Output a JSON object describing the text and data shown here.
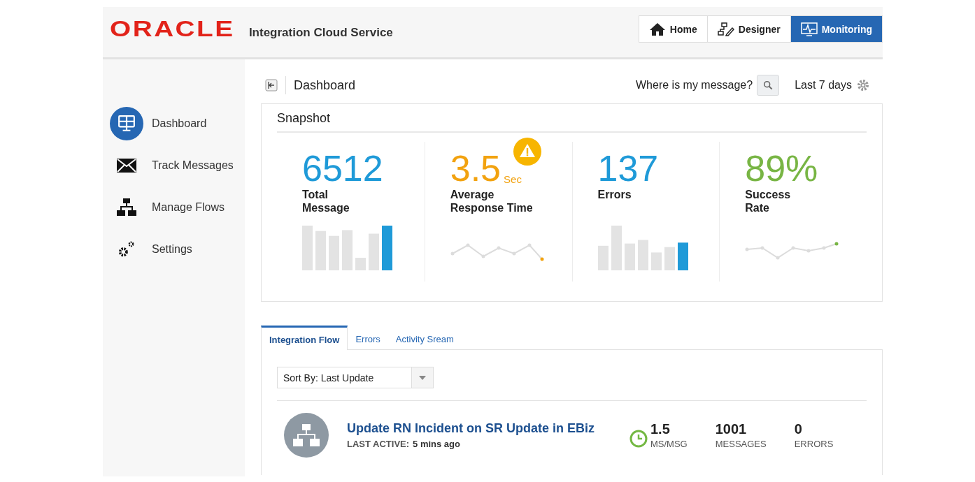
{
  "header": {
    "logo": "ORACLE",
    "product": "Integration Cloud Service",
    "nav": [
      {
        "label": "Home",
        "selected": false
      },
      {
        "label": "Designer",
        "selected": false
      },
      {
        "label": "Monitoring",
        "selected": true
      }
    ]
  },
  "sidebar": {
    "items": [
      {
        "label": "Dashboard",
        "selected": true
      },
      {
        "label": "Track Messages",
        "selected": false
      },
      {
        "label": "Manage Flows",
        "selected": false
      },
      {
        "label": "Settings",
        "selected": false
      }
    ]
  },
  "page": {
    "title": "Dashboard",
    "search_label": "Where is my message?",
    "period": "Last 7 days"
  },
  "snapshot": {
    "title": "Snapshot",
    "cards": [
      {
        "value": "6512",
        "label_lines": [
          "Total",
          "Message"
        ],
        "color": "#1f9ad8",
        "kind": "bars"
      },
      {
        "value": "3.5",
        "unit": "Sec",
        "label_lines": [
          "Average",
          "Response Time"
        ],
        "color": "#f2a20f",
        "warning": true,
        "kind": "line"
      },
      {
        "value": "137",
        "label_lines": [
          "Errors"
        ],
        "color": "#1f9ad8",
        "kind": "bars"
      },
      {
        "value": "89%",
        "label_lines": [
          "Success",
          "Rate"
        ],
        "color": "#78b544",
        "kind": "line"
      }
    ]
  },
  "tabs": [
    {
      "label": "Integration Flow",
      "selected": true
    },
    {
      "label": "Errors",
      "selected": false
    },
    {
      "label": "Activity Sream",
      "selected": false
    }
  ],
  "sort": {
    "value": "Sort By: Last Update"
  },
  "flows": [
    {
      "name": "Update RN Incident on SR Update in EBiz",
      "last_active_label": "LAST ACTIVE:",
      "last_active": "5 mins ago",
      "stats": [
        {
          "value": "1.5",
          "label": "MS/MSG",
          "clock": true
        },
        {
          "value": "1001",
          "label": "MESSAGES"
        },
        {
          "value": "0",
          "label": "ERRORS"
        }
      ]
    }
  ]
}
